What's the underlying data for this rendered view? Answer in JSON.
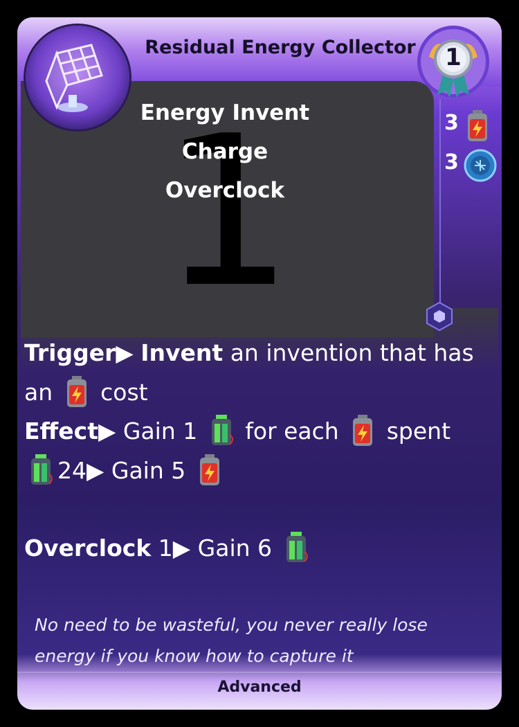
{
  "card": {
    "title": "Residual Energy Collector",
    "subtitle_line1": "Energy Invent Charge",
    "subtitle_line2": "Overclock",
    "art_placeholder": "1",
    "level": "1",
    "costs": [
      {
        "value": "3",
        "icon": "red-battery-icon"
      },
      {
        "value": "3",
        "icon": "blue-circuit-token-icon"
      }
    ],
    "trigger_label": "Trigger",
    "trigger_keyword": "Invent",
    "trigger_text_1": "an invention that has",
    "trigger_text_2": "an",
    "trigger_text_3": "cost",
    "effect_label": "Effect",
    "effect_text_1": "Gain 1",
    "effect_text_2": "for each",
    "effect_text_3": "spent",
    "threshold_value": "24",
    "threshold_text": "Gain 5",
    "overclock_label": "Overclock",
    "overclock_value": "1",
    "overclock_text": "Gain 6",
    "flavor_line1": "No need to be wasteful, you never really lose",
    "flavor_line2": "energy if you know how to capture it",
    "tier": "Advanced"
  },
  "colors": {
    "header": "#b283ee",
    "body": "#2c1d66",
    "art_bg": "#3b3b3f",
    "accent": "#7d6cd8"
  }
}
